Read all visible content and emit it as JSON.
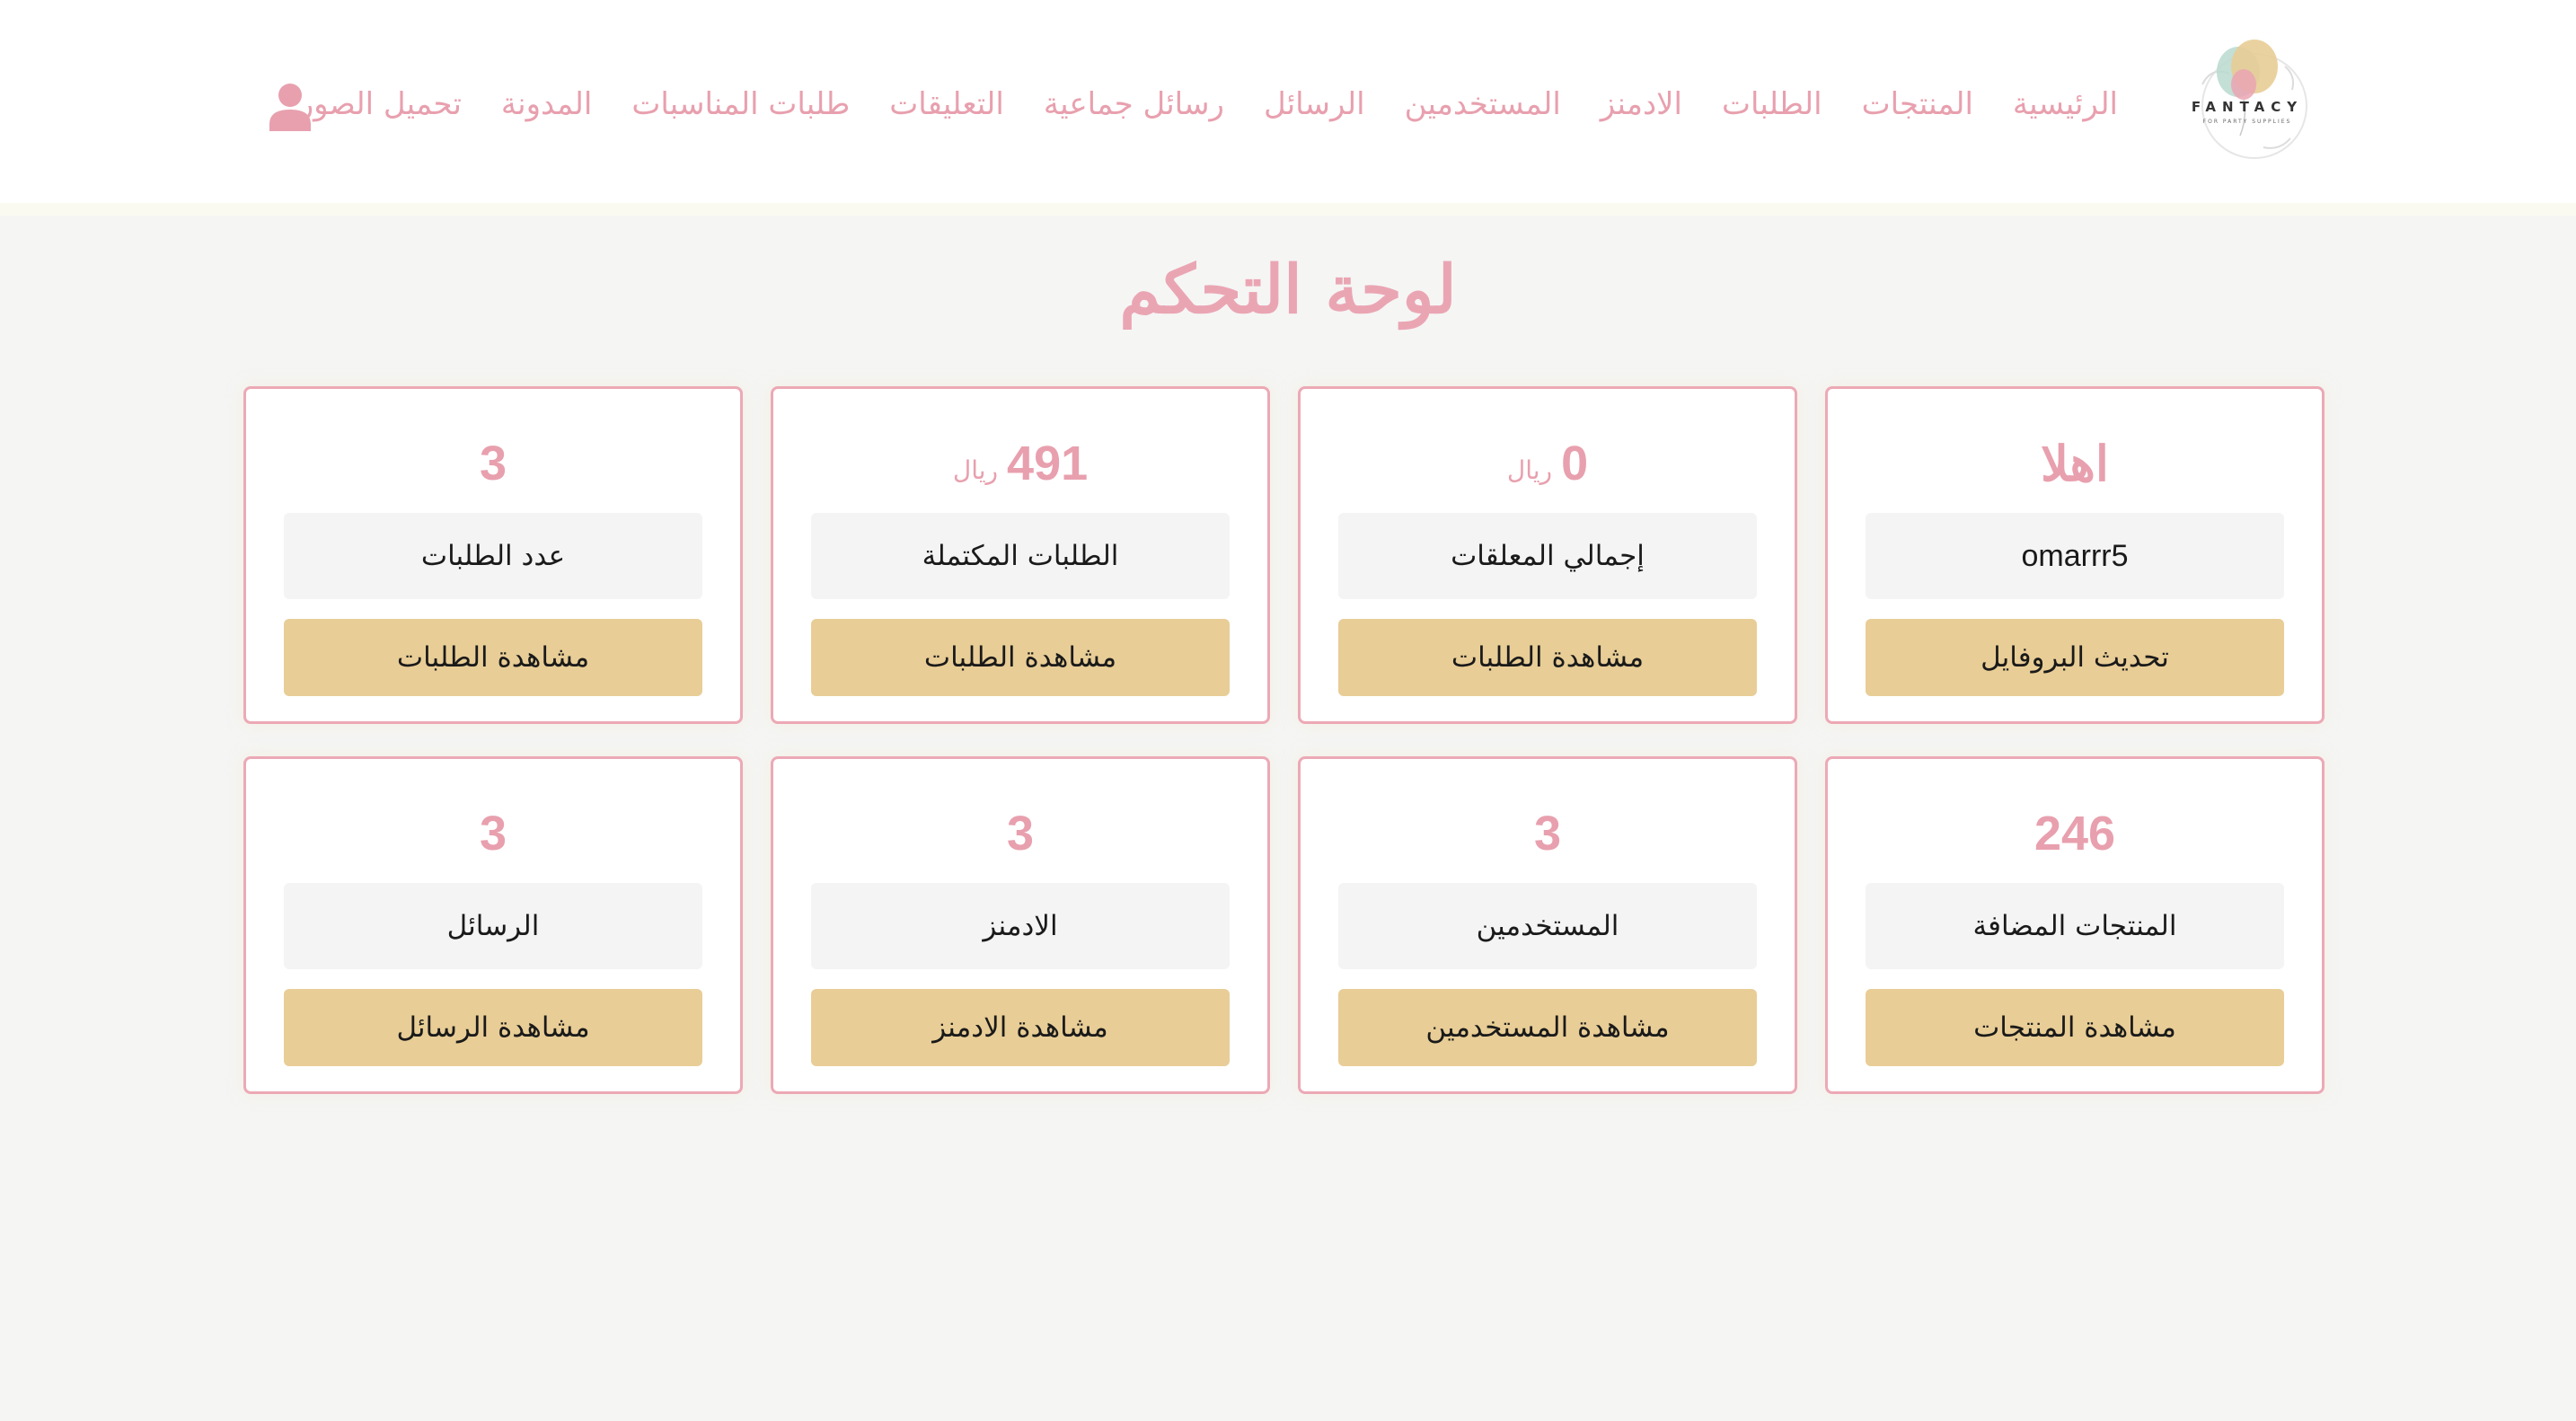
{
  "brand": {
    "name": "FANTACY",
    "tagline": "FOR PARTY SUPPLIES"
  },
  "nav": {
    "items": [
      "الرئيسية",
      "المنتجات",
      "الطلبات",
      "الادمنز",
      "المستخدمين",
      "الرسائل",
      "رسائل جماعية",
      "التعليقات",
      "طلبات المناسبات",
      "المدونة",
      "تحميل الصور"
    ],
    "user_icon": "user-icon"
  },
  "page": {
    "title": "لوحة التحكم"
  },
  "colors": {
    "accent_pink": "#e8a0ae",
    "button_gold": "#e8cd96",
    "card_border": "#eca9b5",
    "background": "#f5f5f4"
  },
  "cards": [
    {
      "value": "اهلا",
      "unit": "",
      "label": "omarrr5",
      "action": "تحديث البروفايل"
    },
    {
      "value": "0",
      "unit": "ريال",
      "label": "إجمالي المعلقات",
      "action": "مشاهدة الطلبات"
    },
    {
      "value": "491",
      "unit": "ريال",
      "label": "الطلبات المكتملة",
      "action": "مشاهدة الطلبات"
    },
    {
      "value": "3",
      "unit": "",
      "label": "عدد الطلبات",
      "action": "مشاهدة الطلبات"
    },
    {
      "value": "246",
      "unit": "",
      "label": "المنتجات المضافة",
      "action": "مشاهدة المنتجات"
    },
    {
      "value": "3",
      "unit": "",
      "label": "المستخدمين",
      "action": "مشاهدة المستخدمين"
    },
    {
      "value": "3",
      "unit": "",
      "label": "الادمنز",
      "action": "مشاهدة الادمنز"
    },
    {
      "value": "3",
      "unit": "",
      "label": "الرسائل",
      "action": "مشاهدة الرسائل"
    }
  ]
}
